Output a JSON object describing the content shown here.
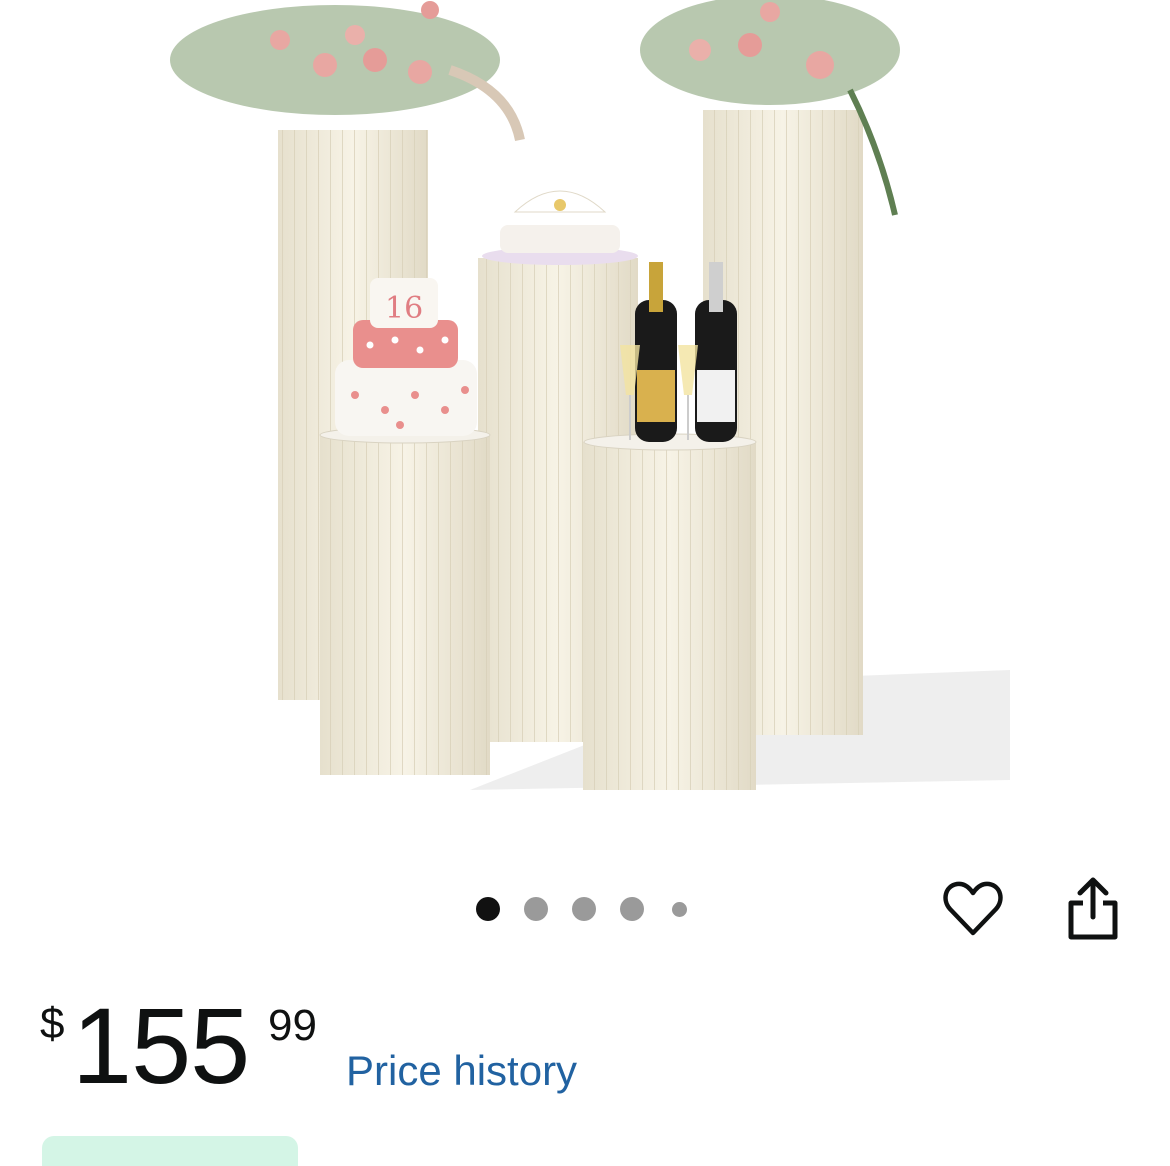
{
  "product": {
    "image_alt": "Set of five cream fluted paper pedestal columns with flowers, tiered cake, and champagne bottles"
  },
  "carousel": {
    "dot_count": 5,
    "active_index": 0
  },
  "actions": {
    "wishlist_icon": "heart-outline-icon",
    "share_icon": "share-upload-icon"
  },
  "price": {
    "currency_symbol": "$",
    "whole": "155",
    "fraction": "99"
  },
  "links": {
    "price_history": "Price history"
  },
  "colors": {
    "link": "#2162a1",
    "badge": "#d4f5e6",
    "pedestal": "#f3eedf"
  }
}
